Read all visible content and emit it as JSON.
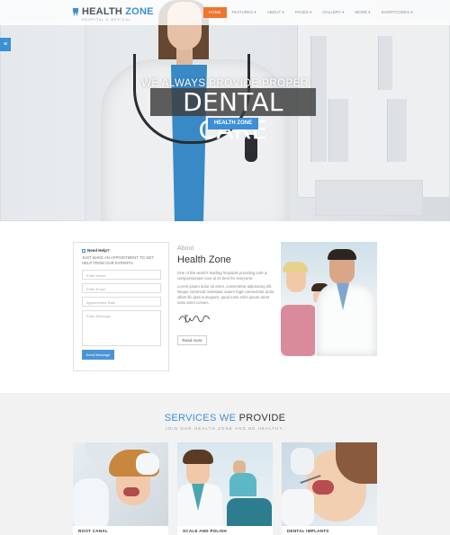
{
  "nav": {
    "logo_main": "HEALTH",
    "logo_accent": "ZONE",
    "logo_tagline": "HOSPITAL & MEDICAL",
    "menu": [
      {
        "label": "HOME",
        "active": true
      },
      {
        "label": "FEATURES ▾",
        "active": false
      },
      {
        "label": "ABOUT ▾",
        "active": false
      },
      {
        "label": "PAGES ▾",
        "active": false
      },
      {
        "label": "GALLERY ▾",
        "active": false
      },
      {
        "label": "MORE ▾",
        "active": false
      },
      {
        "label": "SHORTCODES ▾",
        "active": false
      }
    ],
    "side_tab_icon": "sliders-icon"
  },
  "hero": {
    "kicker": "WE ALWAYS PROVIDE PROPER",
    "title": "DENTAL CARE",
    "tag": "HEALTH ZONE"
  },
  "appointment": {
    "heading": "Need Help?",
    "intro": "JUST MAKE AN APPOINTMENT TO GET HELP FROM OUR EXPERTS",
    "fields": {
      "name": "Enter Name",
      "email": "Enter Email",
      "date": "Appointment Date",
      "message": "Enter Message"
    },
    "send_label": "Send Message"
  },
  "about": {
    "label": "About",
    "title": "Health Zone",
    "lead": "One of the world's leading hospitals providing safe & compassionate care at its best for everyone.",
    "body": "Lorem ipsum dolor sit amet, consectetur adipisicing elit. Neque commodi molestiae autem fugit consectetur dolor ullam illo ipsa numquam, quod iusto enim ipsum amet iusto amet consec.",
    "read_more": "Read more"
  },
  "services": {
    "title_highlight": "SERVICES WE",
    "title_rest": "PROVIDE",
    "subtitle": "JOIN OUR HEALTH ZONE AND BE HEALTHY.",
    "cards": [
      {
        "caption": "ROOT CANAL"
      },
      {
        "caption": "SCALE AND POLISH"
      },
      {
        "caption": "DENTAL IMPLANTS"
      }
    ]
  },
  "colors": {
    "accent_blue": "#3d8fd4",
    "accent_orange": "#f0752d"
  }
}
